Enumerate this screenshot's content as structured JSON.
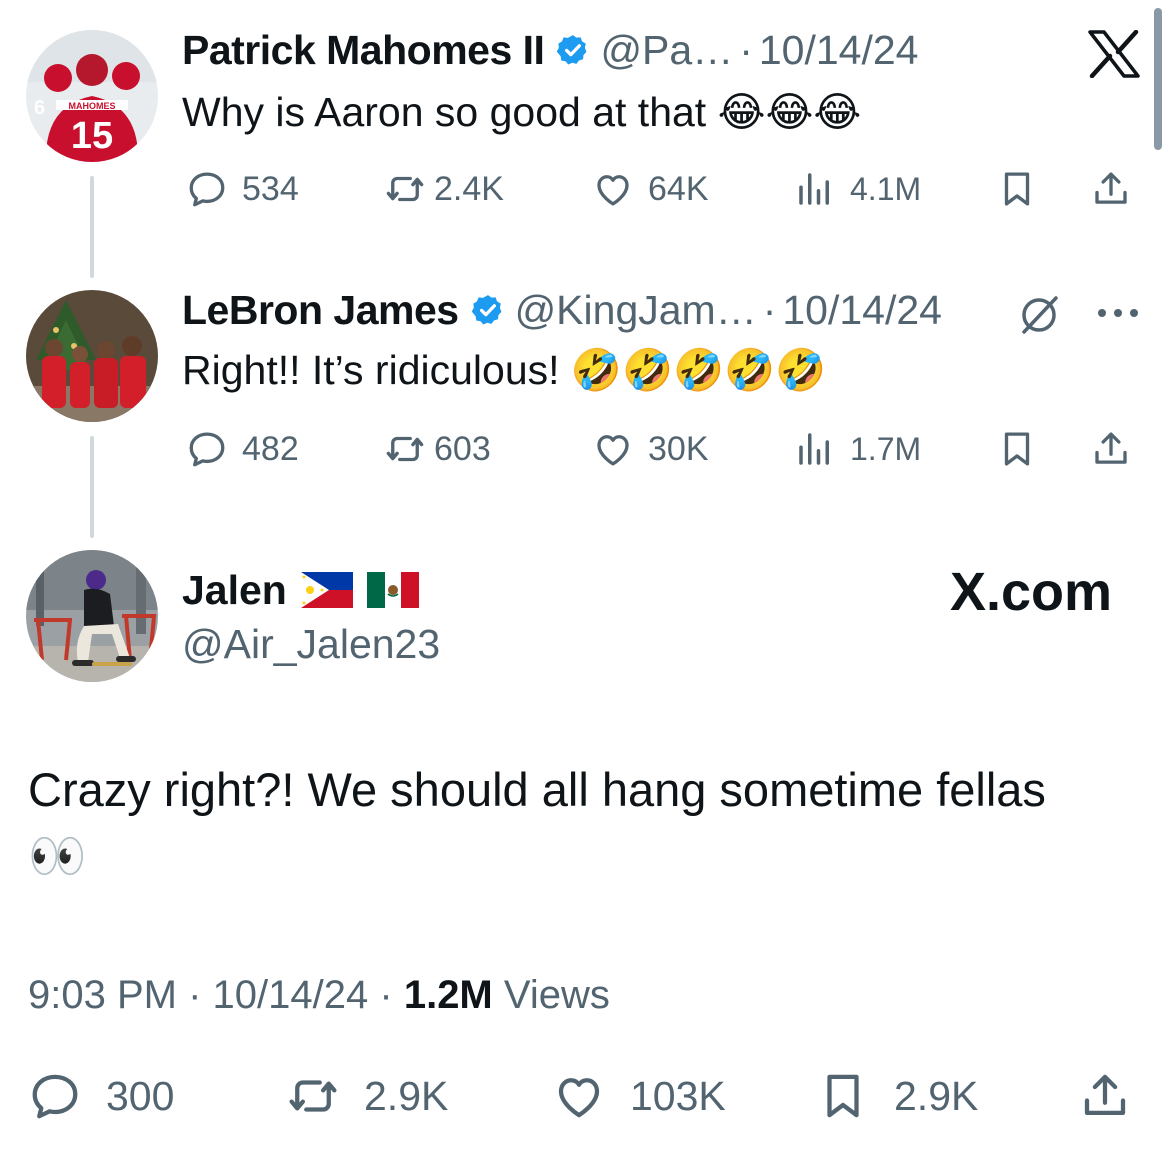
{
  "tweets": [
    {
      "name": "Patrick Mahomes II",
      "handle": "@Pa…",
      "date": "10/14/24",
      "text": "Why is Aaron so good at that 😂😂😂",
      "stats": {
        "replies": "534",
        "reposts": "2.4K",
        "likes": "64K",
        "views": "4.1M"
      }
    },
    {
      "name": "LeBron James",
      "handle": "@KingJam…",
      "date": "10/14/24",
      "text": "Right!! It’s ridiculous! 🤣🤣🤣🤣🤣",
      "stats": {
        "replies": "482",
        "reposts": "603",
        "likes": "30K",
        "views": "1.7M"
      }
    }
  ],
  "main_tweet": {
    "name": "Jalen",
    "flags": [
      "🇵🇭",
      "🇲🇽"
    ],
    "handle": "@Air_Jalen23",
    "watermark": "X.com",
    "text": "Crazy right?! We should all hang sometime fellas",
    "emoji": "👀",
    "time": "9:03 PM",
    "date": "10/14/24",
    "views_count": "1.2M",
    "views_label": "Views",
    "stats": {
      "replies": "300",
      "reposts": "2.9K",
      "likes": "103K",
      "bookmarks": "2.9K"
    }
  },
  "separator": "·",
  "icons": {
    "verified": "verified-badge-icon",
    "x_logo": "x-logo-icon",
    "grok": "grok-slash-icon",
    "more": "more-dots-icon",
    "reply": "reply-icon",
    "repost": "repost-icon",
    "like": "heart-icon",
    "views": "views-chart-icon",
    "bookmark": "bookmark-icon",
    "share": "share-icon"
  },
  "colors": {
    "text": "#0f1419",
    "muted": "#536471",
    "verified": "#1d9bf0",
    "thread_line": "#cfd9de"
  }
}
